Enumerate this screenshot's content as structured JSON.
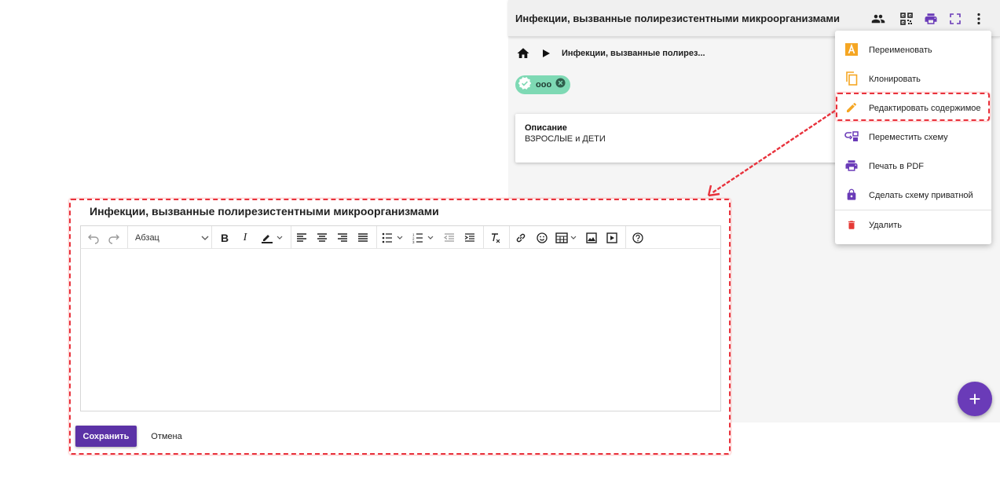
{
  "header": {
    "title": "Инфекции, вызванные полирезистентными микроорганизмами",
    "icons": [
      "users-icon",
      "qr-code-icon",
      "print-icon",
      "fullscreen-icon",
      "more-vert-icon"
    ]
  },
  "breadcrumb": {
    "current": "Инфекции, вызванные полирез..."
  },
  "chip": {
    "label": "ооо"
  },
  "description": {
    "title": "Описание",
    "value": "ВЗРОСЛЫЕ и ДЕТИ"
  },
  "menu": {
    "items": [
      {
        "label": "Переименовать",
        "icon": "rename-icon"
      },
      {
        "label": "Клонировать",
        "icon": "copy-icon"
      },
      {
        "label": "Редактировать содержимое",
        "icon": "edit-pencil-icon"
      },
      {
        "label": "Переместить схему",
        "icon": "move-icon"
      },
      {
        "label": "Печать в PDF",
        "icon": "print-icon"
      },
      {
        "label": "Сделать схему приватной",
        "icon": "lock-icon"
      },
      {
        "label": "Удалить",
        "icon": "trash-icon"
      }
    ],
    "highlighted_index": 2
  },
  "editor": {
    "title": "Инфекции, вызванные полирезистентными микроорганизмами",
    "format_select": "Абзац",
    "content": "",
    "save_label": "Сохранить",
    "cancel_label": "Отмена"
  },
  "fab": {
    "label": "+"
  },
  "colors": {
    "accent_purple": "#5b32a6",
    "highlight_red": "#e8323c",
    "chip_green": "#7ed9b4",
    "menu_orange": "#f5a623",
    "menu_delete_red": "#e53935"
  }
}
